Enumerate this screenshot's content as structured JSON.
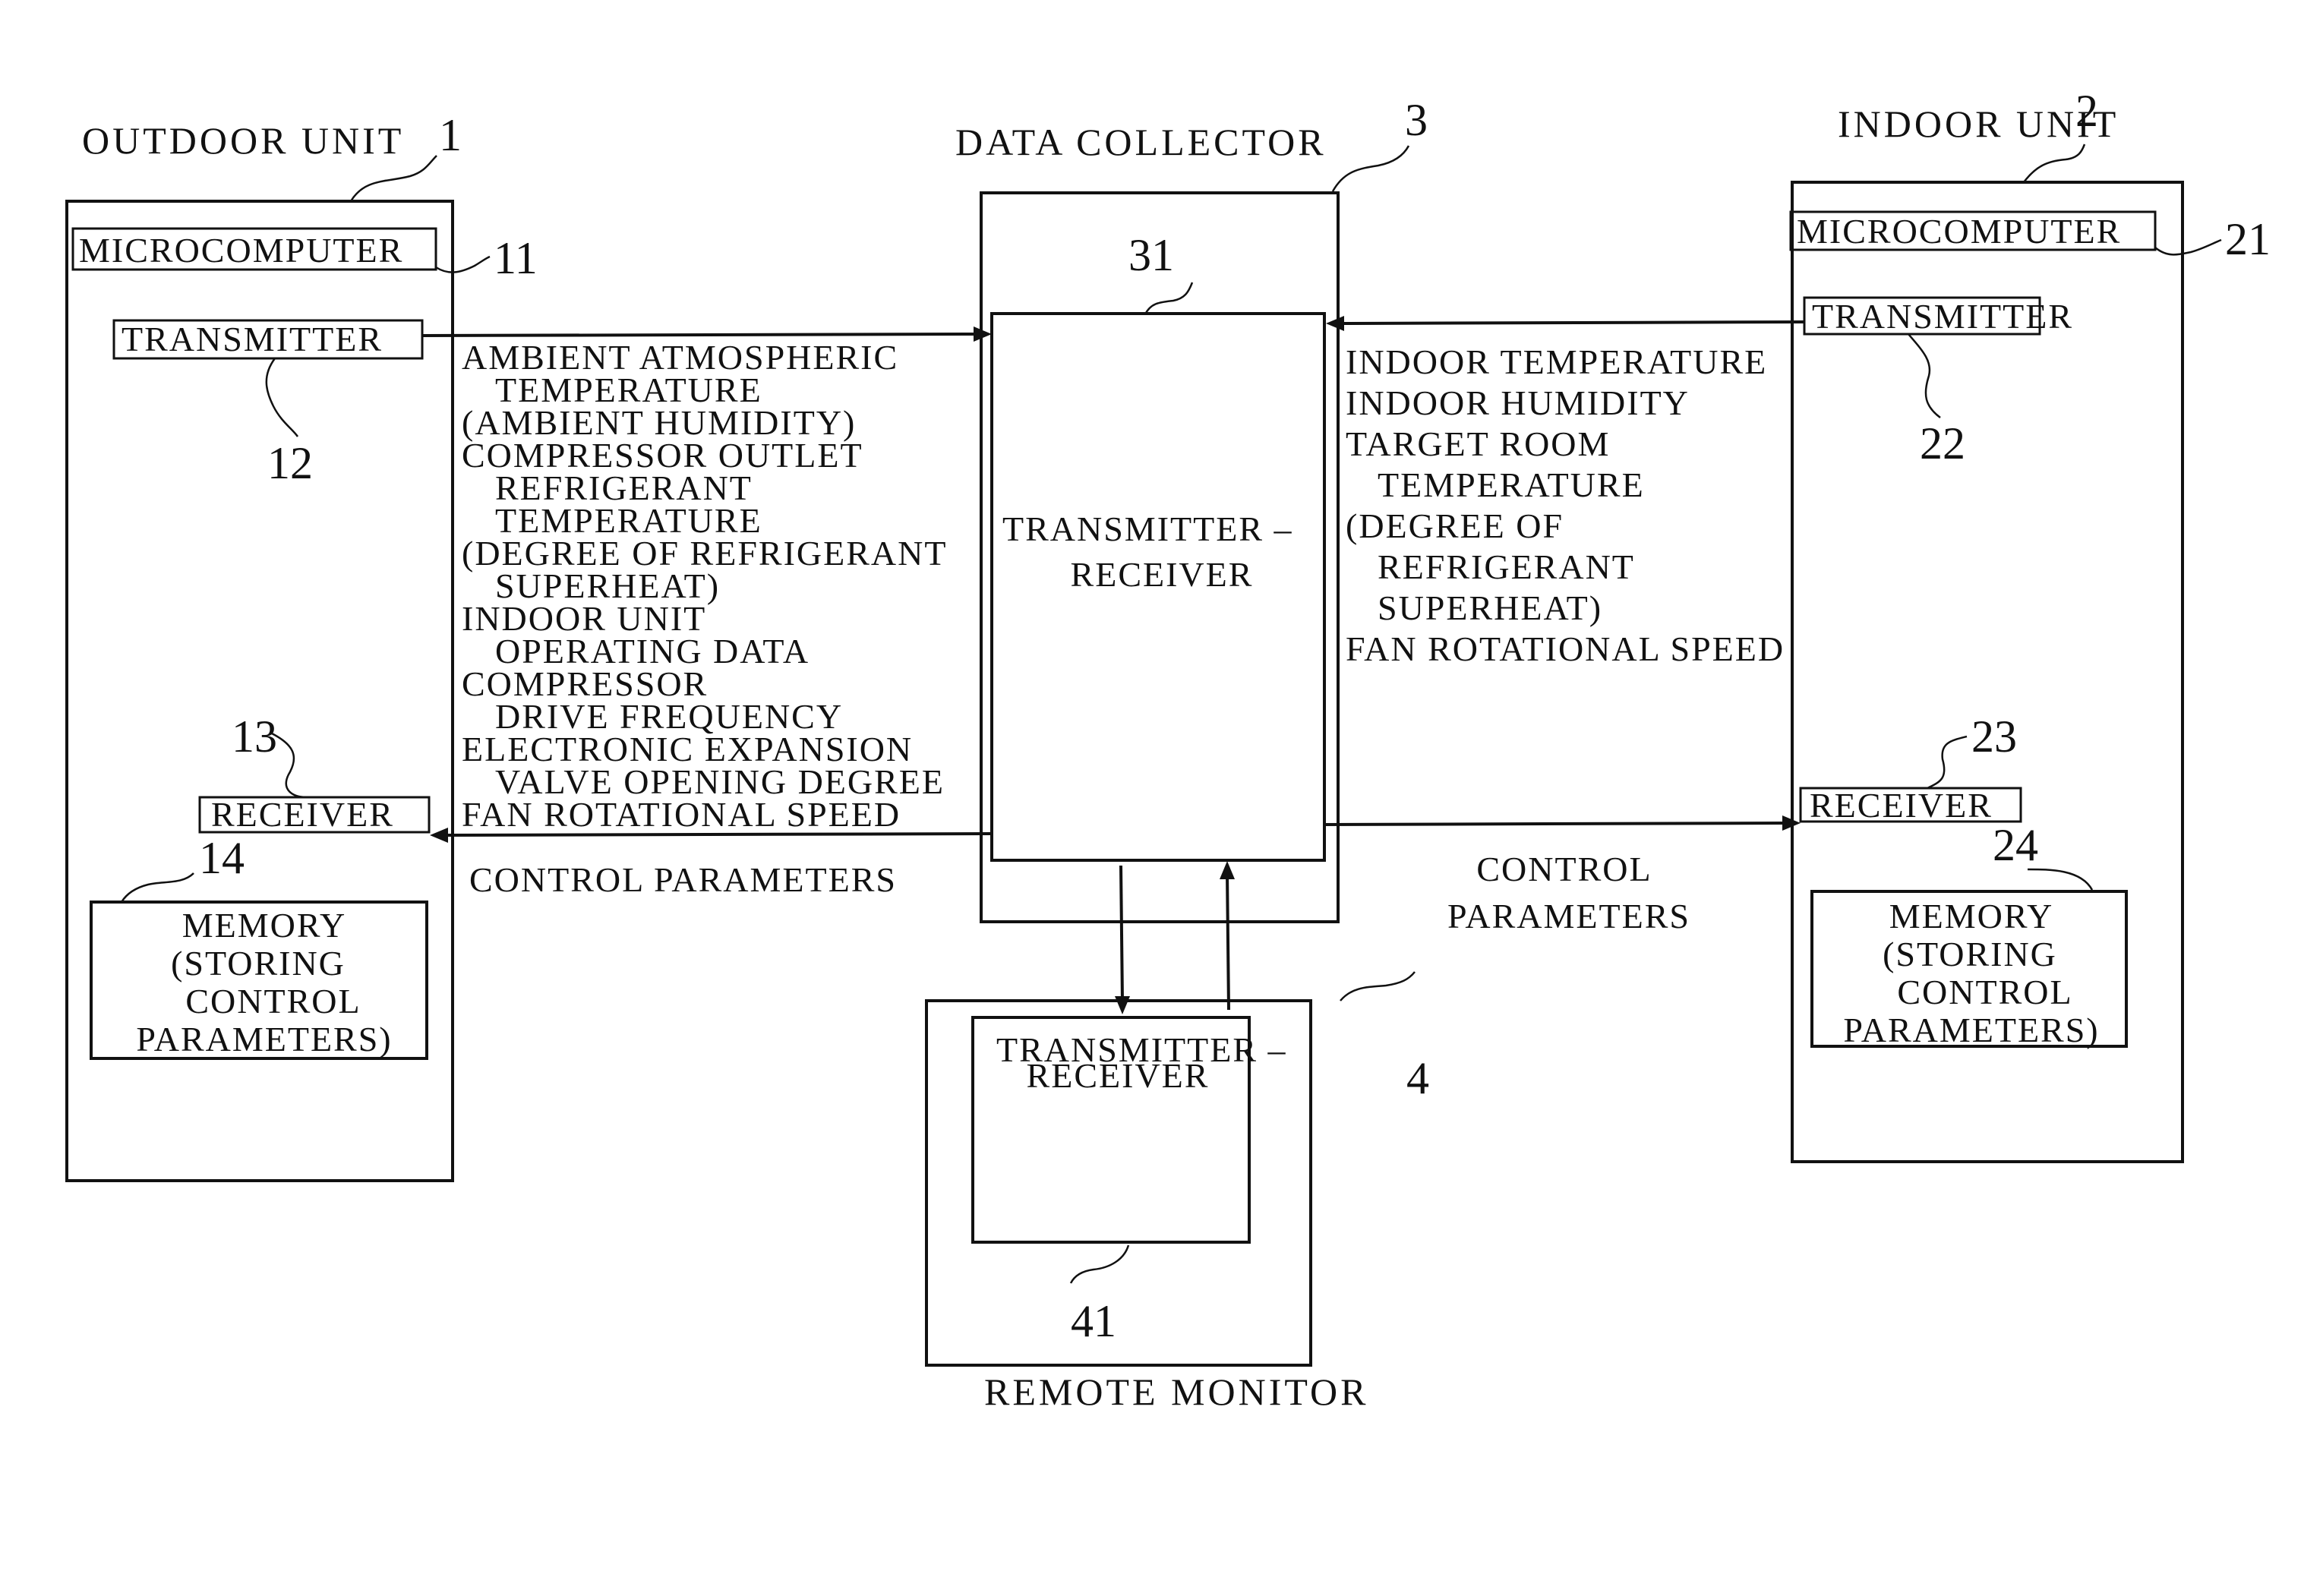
{
  "diagram": {
    "outdoor_unit": {
      "title": "OUTDOOR UNIT",
      "ref": "1",
      "microcomputer": {
        "label": "MICROCOMPUTER",
        "ref": "11"
      },
      "transmitter": {
        "label": "TRANSMITTER",
        "ref": "12"
      },
      "receiver": {
        "label": "RECEIVER",
        "ref": "13"
      },
      "memory": {
        "lines": [
          "MEMORY",
          "(STORING",
          "CONTROL",
          "PARAMETERS)"
        ],
        "ref": "14"
      }
    },
    "indoor_unit": {
      "title": "INDOOR UNIT",
      "ref": "2",
      "microcomputer": {
        "label": "MICROCOMPUTER",
        "ref": "21"
      },
      "transmitter": {
        "label": "TRANSMITTER",
        "ref": "22"
      },
      "receiver": {
        "label": "RECEIVER",
        "ref": "23"
      },
      "memory": {
        "lines": [
          "MEMORY",
          "(STORING",
          "CONTROL",
          "PARAMETERS)"
        ],
        "ref": "24"
      }
    },
    "data_collector": {
      "title": "DATA COLLECTOR",
      "ref": "3",
      "transceiver": {
        "lines": [
          "TRANSMITTER –",
          "RECEIVER"
        ],
        "ref": "31"
      }
    },
    "remote_monitor": {
      "title": "REMOTE MONITOR",
      "ref": "4",
      "transceiver": {
        "lines": [
          "TRANSMITTER –",
          "RECEIVER"
        ],
        "ref": "41"
      }
    },
    "outdoor_to_collector_data": [
      "AMBIENT ATMOSPHERIC",
      "  TEMPERATURE",
      "(AMBIENT HUMIDITY)",
      "COMPRESSOR OUTLET",
      "  REFRIGERANT",
      "  TEMPERATURE",
      "(DEGREE OF REFRIGERANT",
      "  SUPERHEAT)",
      "INDOOR UNIT",
      "  OPERATING DATA",
      "COMPRESSOR",
      "  DRIVE FREQUENCY",
      "ELECTRONIC EXPANSION",
      "  VALVE OPENING DEGREE",
      "FAN ROTATIONAL SPEED"
    ],
    "indoor_to_collector_data": [
      "INDOOR TEMPERATURE",
      "INDOOR HUMIDITY",
      "TARGET ROOM",
      "  TEMPERATURE",
      "(DEGREE OF",
      "  REFRIGERANT",
      "  SUPERHEAT)",
      "FAN ROTATIONAL SPEED"
    ],
    "collector_to_outdoor_label": "CONTROL PARAMETERS",
    "collector_to_indoor_label": [
      "CONTROL",
      "PARAMETERS"
    ]
  }
}
